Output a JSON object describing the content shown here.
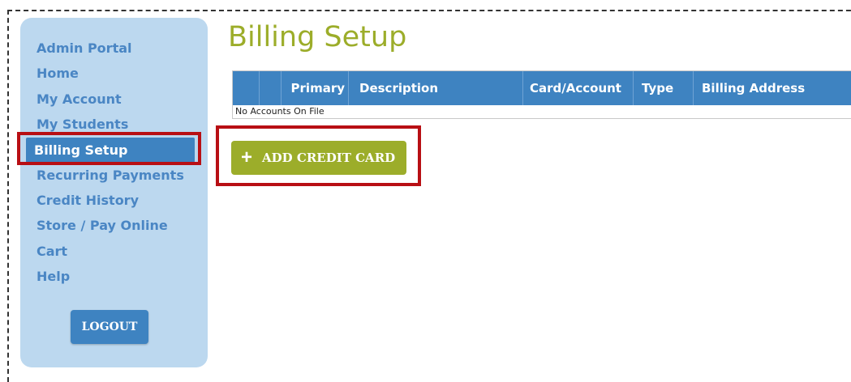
{
  "sidebar": {
    "items": [
      {
        "label": "Admin Portal"
      },
      {
        "label": "Home"
      },
      {
        "label": "My Account"
      },
      {
        "label": "My Students"
      },
      {
        "label": "Billing Setup",
        "active": true
      },
      {
        "label": "Recurring Payments"
      },
      {
        "label": "Credit History"
      },
      {
        "label": "Store / Pay Online"
      },
      {
        "label": "Cart"
      },
      {
        "label": "Help"
      }
    ],
    "logout_label": "LOGOUT"
  },
  "main": {
    "title": "Billing Setup",
    "table": {
      "columns": [
        "",
        "",
        "Primary",
        "Description",
        "Card/Account",
        "Type",
        "Billing Address"
      ],
      "empty_message": "No Accounts On File"
    },
    "add_button": {
      "icon": "plus-icon",
      "label": "ADD CREDIT CARD"
    }
  },
  "colors": {
    "sidebar_bg": "#bcd8ef",
    "link": "#4a86c4",
    "accent_blue": "#3e83c1",
    "accent_green": "#9cad2a",
    "highlight": "#b80f14"
  }
}
